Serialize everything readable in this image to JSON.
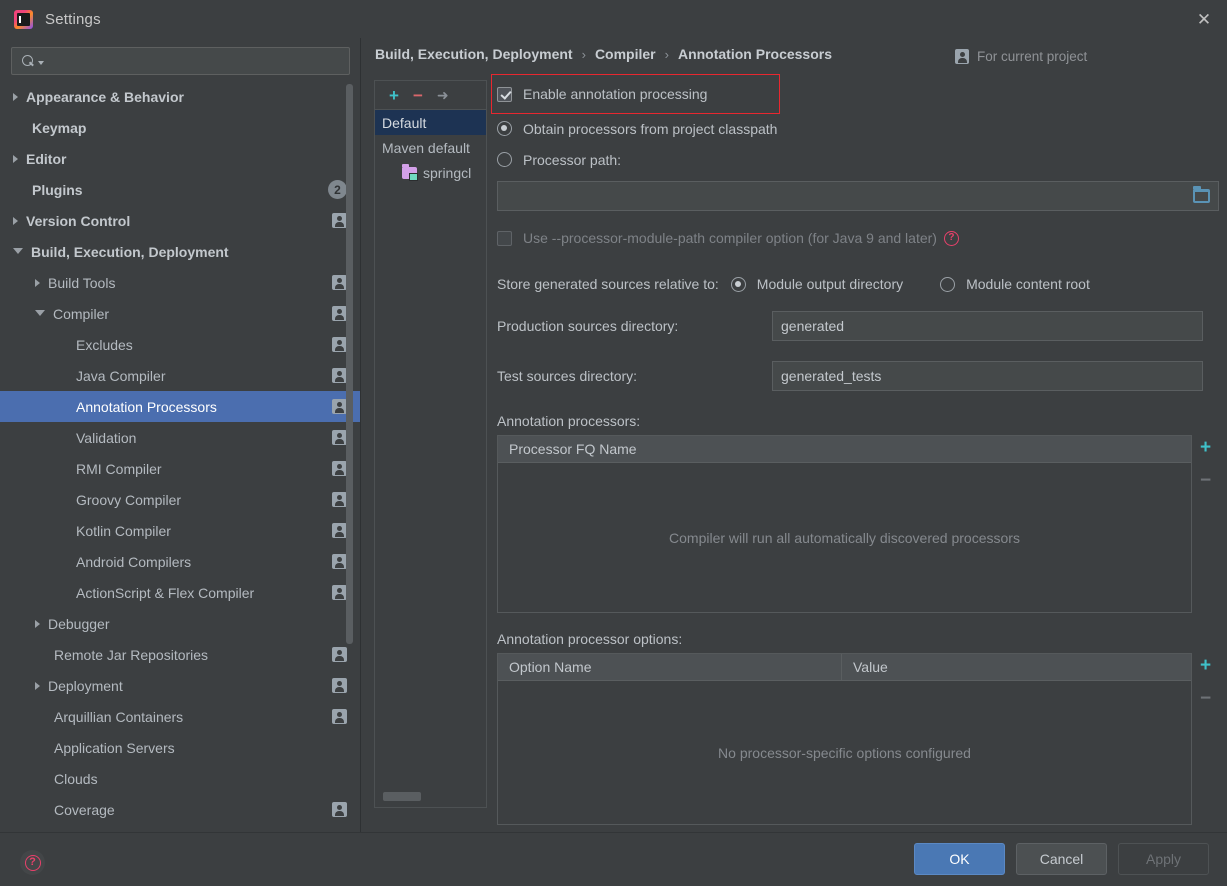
{
  "window": {
    "title": "Settings",
    "close_label": "✕",
    "logo_icon": "intellij-idea-logo"
  },
  "sidebar": {
    "search": {
      "placeholder": "",
      "value": "",
      "icon": "search-icon"
    },
    "items": [
      {
        "label": "Appearance & Behavior",
        "level": 0,
        "arrow": "collapsed",
        "badge": ""
      },
      {
        "label": "Keymap",
        "level": 0,
        "arrow": "none",
        "badge": ""
      },
      {
        "label": "Editor",
        "level": 0,
        "arrow": "collapsed",
        "badge": ""
      },
      {
        "label": "Plugins",
        "level": 0,
        "arrow": "none",
        "badge": "count",
        "count": "2"
      },
      {
        "label": "Version Control",
        "level": 0,
        "arrow": "collapsed",
        "badge": "person"
      },
      {
        "label": "Build, Execution, Deployment",
        "level": 0,
        "arrow": "expanded",
        "badge": ""
      },
      {
        "label": "Build Tools",
        "level": 1,
        "arrow": "collapsed",
        "badge": "person"
      },
      {
        "label": "Compiler",
        "level": 1,
        "arrow": "expanded",
        "badge": "person"
      },
      {
        "label": "Excludes",
        "level": 2,
        "arrow": "none",
        "badge": "person"
      },
      {
        "label": "Java Compiler",
        "level": 2,
        "arrow": "none",
        "badge": "person"
      },
      {
        "label": "Annotation Processors",
        "level": 2,
        "arrow": "none",
        "badge": "person",
        "selected": true
      },
      {
        "label": "Validation",
        "level": 2,
        "arrow": "none",
        "badge": "person"
      },
      {
        "label": "RMI Compiler",
        "level": 2,
        "arrow": "none",
        "badge": "person"
      },
      {
        "label": "Groovy Compiler",
        "level": 2,
        "arrow": "none",
        "badge": "person"
      },
      {
        "label": "Kotlin Compiler",
        "level": 2,
        "arrow": "none",
        "badge": "person"
      },
      {
        "label": "Android Compilers",
        "level": 2,
        "arrow": "none",
        "badge": "person"
      },
      {
        "label": "ActionScript & Flex Compiler",
        "level": 2,
        "arrow": "none",
        "badge": "person"
      },
      {
        "label": "Debugger",
        "level": 1,
        "arrow": "collapsed",
        "badge": ""
      },
      {
        "label": "Remote Jar Repositories",
        "level": 1,
        "arrow": "none",
        "badge": "person"
      },
      {
        "label": "Deployment",
        "level": 1,
        "arrow": "collapsed",
        "badge": "person"
      },
      {
        "label": "Arquillian Containers",
        "level": 1,
        "arrow": "none",
        "badge": "person"
      },
      {
        "label": "Application Servers",
        "level": 1,
        "arrow": "none",
        "badge": ""
      },
      {
        "label": "Clouds",
        "level": 1,
        "arrow": "none",
        "badge": ""
      },
      {
        "label": "Coverage",
        "level": 1,
        "arrow": "none",
        "badge": "person"
      }
    ]
  },
  "header": {
    "breadcrumb": [
      "Build, Execution, Deployment",
      "Compiler",
      "Annotation Processors"
    ],
    "separator": "›",
    "scope_label": "For current project",
    "scope_icon": "person-badge-icon"
  },
  "profiles": {
    "toolbar": {
      "add": "+",
      "remove": "−",
      "move": "➜"
    },
    "items": [
      {
        "label": "Default",
        "selected": true,
        "icon": ""
      },
      {
        "label": "Maven default",
        "selected": false,
        "icon": ""
      },
      {
        "label": "springcl",
        "selected": false,
        "icon": "module-folder-icon",
        "indent": true
      }
    ]
  },
  "settings": {
    "enable_processing": {
      "label": "Enable annotation processing",
      "checked": true,
      "highlighted": true
    },
    "source_mode": {
      "selected": "obtain_classpath",
      "options": [
        {
          "id": "obtain_classpath",
          "label": "Obtain processors from project classpath",
          "selected": true
        },
        {
          "id": "processor_path",
          "label": "Processor path:",
          "selected": false
        }
      ]
    },
    "processor_path_field": {
      "value": "",
      "browse_icon": "folder-browse-icon"
    },
    "module_path_option": {
      "label": "Use --processor-module-path compiler option (for Java 9 and later)",
      "checked": false,
      "disabled": true,
      "help_icon": "help-question-icon"
    },
    "store_relative": {
      "label": "Store generated sources relative to:",
      "options": [
        {
          "id": "module_output",
          "label": "Module output directory",
          "selected": true
        },
        {
          "id": "module_content",
          "label": "Module content root",
          "selected": false
        }
      ]
    },
    "production_dir": {
      "label": "Production sources directory:",
      "value": "generated"
    },
    "test_dir": {
      "label": "Test sources directory:",
      "value": "generated_tests"
    },
    "processors_table": {
      "label": "Annotation processors:",
      "columns": [
        "Processor FQ Name"
      ],
      "rows": [],
      "empty_text": "Compiler will run all automatically discovered processors",
      "add": "+",
      "remove": "−"
    },
    "options_table": {
      "label": "Annotation processor options:",
      "columns": [
        "Option Name",
        "Value"
      ],
      "rows": [],
      "empty_text": "No processor-specific options configured",
      "add": "+",
      "remove": "−"
    }
  },
  "footer": {
    "help_icon": "help-question-icon",
    "ok": "OK",
    "cancel": "Cancel",
    "apply": "Apply"
  },
  "colors": {
    "background": "#3c3f41",
    "selection_blue": "#4b6eaf",
    "profile_selection": "#1d3353",
    "accent_cyan": "#3fc1c9",
    "accent_red": "#e8272f",
    "help_pink": "#e8416b",
    "primary_button": "#4a78b4"
  }
}
